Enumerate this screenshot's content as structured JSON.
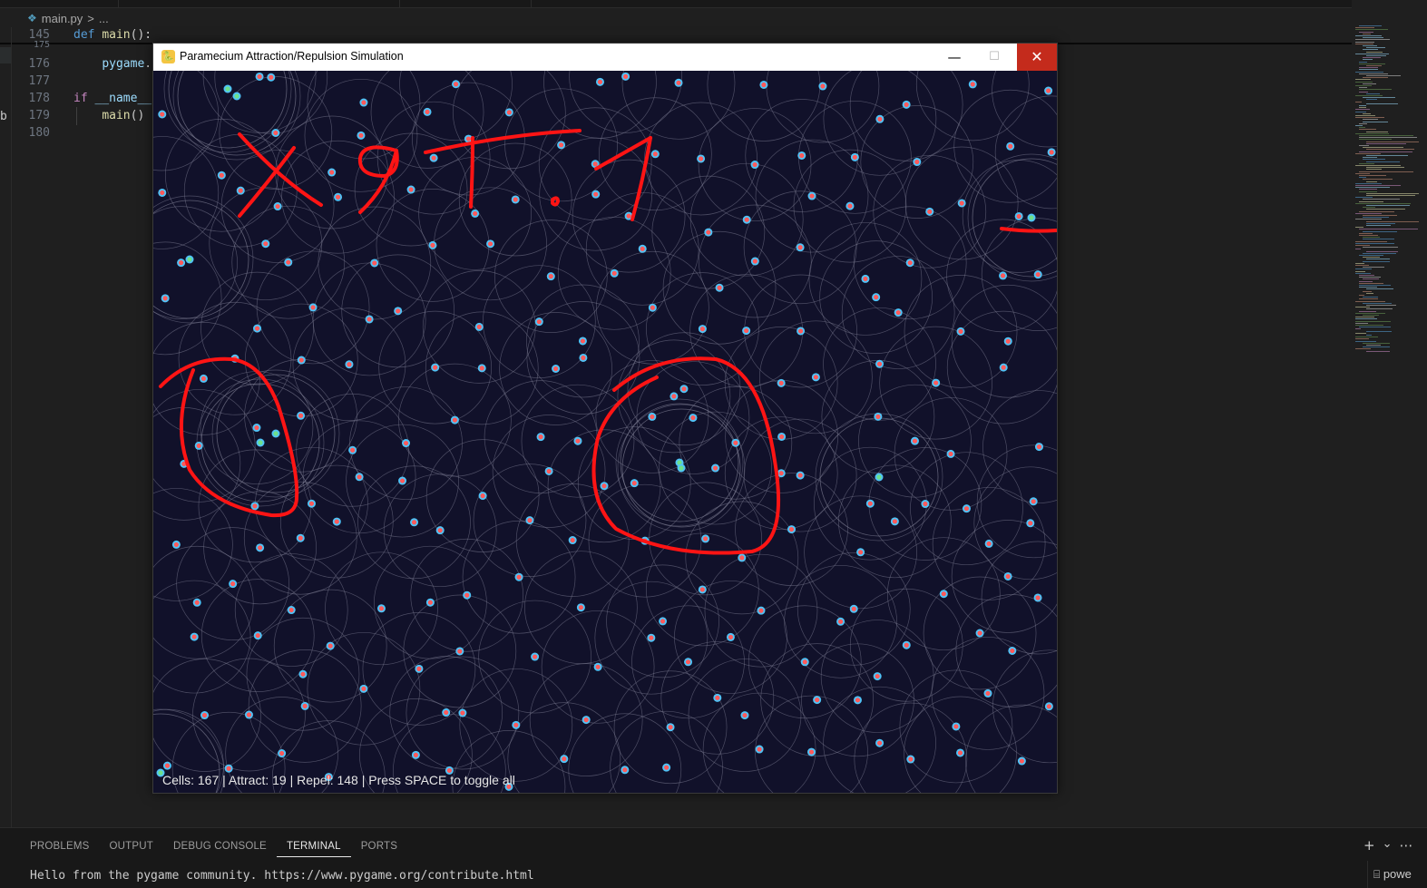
{
  "editor": {
    "breadcrumb": {
      "file": "main.py",
      "separator": ">",
      "rest": "..."
    },
    "left_fragment": "b",
    "lines": [
      {
        "num": "145",
        "parts": [
          {
            "t": "def",
            "c": "kw"
          },
          {
            "t": " ",
            "c": "plain"
          },
          {
            "t": "main",
            "c": "fn"
          },
          {
            "t": "():",
            "c": "plain"
          }
        ]
      },
      {
        "num": "175",
        "parts": []
      },
      {
        "num": "176",
        "parts": [
          {
            "t": "    ",
            "c": "plain"
          },
          {
            "t": "pygame",
            "c": "var"
          },
          {
            "t": ".",
            "c": "plain"
          }
        ]
      },
      {
        "num": "177",
        "parts": []
      },
      {
        "num": "178",
        "parts": [
          {
            "t": "if",
            "c": "ctl"
          },
          {
            "t": " ",
            "c": "plain"
          },
          {
            "t": "__name__",
            "c": "var"
          }
        ]
      },
      {
        "num": "179",
        "parts": [
          {
            "t": "    ",
            "c": "plain"
          },
          {
            "t": "main",
            "c": "fn"
          },
          {
            "t": "()",
            "c": "plain"
          }
        ]
      },
      {
        "num": "180",
        "parts": []
      }
    ]
  },
  "sim_window": {
    "title": "Paramecium Attraction/Repulsion Simulation",
    "minimize_glyph": "—",
    "maximize_glyph": "☐",
    "close_glyph": "✕",
    "status": "Cells: 167 | Attract: 19 | Repel: 148 | Press SPACE to toggle all",
    "annotation": "X9T.1",
    "colors": {
      "background": "#11112a",
      "repel_cell": "#ff5a5a",
      "attract_cell": "#6ee08a",
      "cell_ring": "#4fc3f7",
      "radius_circle": "#7d7d93",
      "ink": "#ff1414"
    }
  },
  "panel": {
    "tabs": [
      {
        "label": "PROBLEMS",
        "active": false
      },
      {
        "label": "OUTPUT",
        "active": false
      },
      {
        "label": "DEBUG CONSOLE",
        "active": false
      },
      {
        "label": "TERMINAL",
        "active": true
      },
      {
        "label": "PORTS",
        "active": false
      }
    ],
    "terminal_output": "Hello from the pygame community. https://www.pygame.org/contribute.html",
    "add_glyph": "+",
    "dropdown_glyph": "⌄",
    "more_glyph": "⋯",
    "terminal_name": "powe"
  }
}
